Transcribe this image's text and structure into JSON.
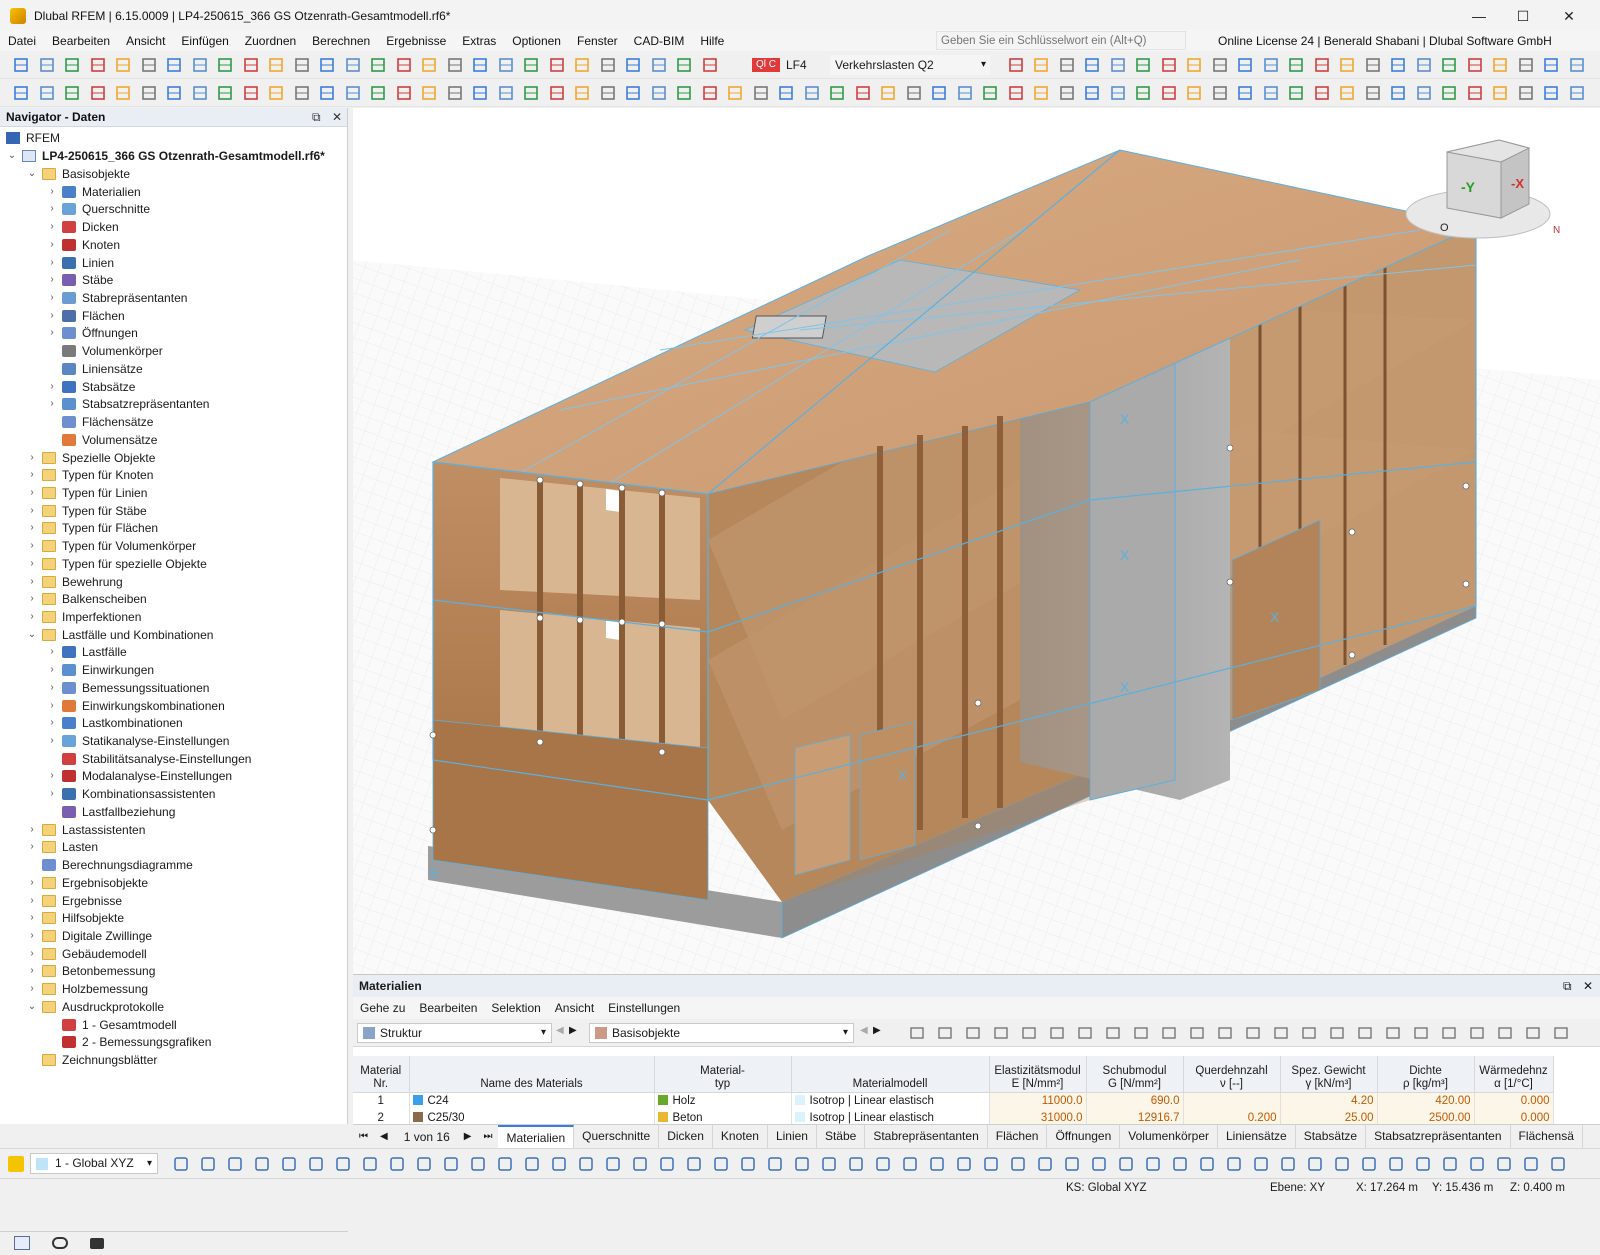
{
  "window": {
    "title": "Dlubal RFEM | 6.15.0009 | LP4-250615_366 GS Otzenrath-Gesamtmodell.rf6*",
    "minimize": "—",
    "maximize": "☐",
    "close": "✕"
  },
  "menubar": {
    "items": [
      "Datei",
      "Bearbeiten",
      "Ansicht",
      "Einfügen",
      "Zuordnen",
      "Berechnen",
      "Ergebnisse",
      "Extras",
      "Optionen",
      "Fenster",
      "CAD-BIM",
      "Hilfe"
    ],
    "search_placeholder": "Geben Sie ein Schlüsselwort ein (Alt+Q)",
    "license": "Online License 24 | Benerald Shabani | Dlubal Software GmbH"
  },
  "loadcase": {
    "badge": "Ql C",
    "name": "LF4",
    "description": "Verkehrslasten Q2"
  },
  "navigator": {
    "title": "Navigator - Daten",
    "root": "RFEM",
    "model": "LP4-250615_366 GS Otzenrath-Gesamtmodell.rf6*",
    "items": [
      {
        "label": "Basisobjekte",
        "level": 1,
        "expanded": true,
        "icon": "folder"
      },
      {
        "label": "Materialien",
        "level": 2,
        "icon": "materials-icon"
      },
      {
        "label": "Querschnitte",
        "level": 2,
        "icon": "cross-section-icon"
      },
      {
        "label": "Dicken",
        "level": 2,
        "icon": "thickness-icon"
      },
      {
        "label": "Knoten",
        "level": 2,
        "icon": "node-icon"
      },
      {
        "label": "Linien",
        "level": 2,
        "icon": "line-icon"
      },
      {
        "label": "Stäbe",
        "level": 2,
        "icon": "member-icon"
      },
      {
        "label": "Stabrepräsentanten",
        "level": 2,
        "icon": "member-rep-icon"
      },
      {
        "label": "Flächen",
        "level": 2,
        "icon": "surface-icon"
      },
      {
        "label": "Öffnungen",
        "level": 2,
        "icon": "opening-icon"
      },
      {
        "label": "Volumenkörper",
        "level": 2,
        "noexpand": true,
        "icon": "solid-icon"
      },
      {
        "label": "Liniensätze",
        "level": 2,
        "noexpand": true,
        "icon": "line-set-icon"
      },
      {
        "label": "Stabsätze",
        "level": 2,
        "icon": "member-set-icon"
      },
      {
        "label": "Stabsatzrepräsentanten",
        "level": 2,
        "icon": "member-set-rep-icon"
      },
      {
        "label": "Flächensätze",
        "level": 2,
        "noexpand": true,
        "icon": "surface-set-icon"
      },
      {
        "label": "Volumensätze",
        "level": 2,
        "noexpand": true,
        "icon": "solid-set-icon"
      },
      {
        "label": "Spezielle Objekte",
        "level": 1,
        "icon": "folder"
      },
      {
        "label": "Typen für Knoten",
        "level": 1,
        "icon": "folder"
      },
      {
        "label": "Typen für Linien",
        "level": 1,
        "icon": "folder"
      },
      {
        "label": "Typen für Stäbe",
        "level": 1,
        "icon": "folder"
      },
      {
        "label": "Typen für Flächen",
        "level": 1,
        "icon": "folder"
      },
      {
        "label": "Typen für Volumenkörper",
        "level": 1,
        "icon": "folder"
      },
      {
        "label": "Typen für spezielle Objekte",
        "level": 1,
        "icon": "folder"
      },
      {
        "label": "Bewehrung",
        "level": 1,
        "icon": "folder"
      },
      {
        "label": "Balkenscheiben",
        "level": 1,
        "icon": "folder"
      },
      {
        "label": "Imperfektionen",
        "level": 1,
        "icon": "folder"
      },
      {
        "label": "Lastfälle und Kombinationen",
        "level": 1,
        "expanded": true,
        "icon": "folder"
      },
      {
        "label": "Lastfälle",
        "level": 2,
        "icon": "load-case-icon"
      },
      {
        "label": "Einwirkungen",
        "level": 2,
        "icon": "action-icon"
      },
      {
        "label": "Bemessungssituationen",
        "level": 2,
        "icon": "design-situation-icon"
      },
      {
        "label": "Einwirkungskombinationen",
        "level": 2,
        "icon": "action-combination-icon"
      },
      {
        "label": "Lastkombinationen",
        "level": 2,
        "icon": "load-combination-icon"
      },
      {
        "label": "Statikanalyse-Einstellungen",
        "level": 2,
        "icon": "static-settings-icon"
      },
      {
        "label": "Stabilitätsanalyse-Einstellungen",
        "level": 2,
        "noexpand": true,
        "icon": "stability-settings-icon"
      },
      {
        "label": "Modalanalyse-Einstellungen",
        "level": 2,
        "icon": "modal-settings-icon"
      },
      {
        "label": "Kombinationsassistenten",
        "level": 2,
        "icon": "combination-wizard-icon"
      },
      {
        "label": "Lastfallbeziehung",
        "level": 2,
        "noexpand": true,
        "icon": "relationship-icon"
      },
      {
        "label": "Lastassistenten",
        "level": 1,
        "icon": "folder"
      },
      {
        "label": "Lasten",
        "level": 1,
        "icon": "folder"
      },
      {
        "label": "Berechnungsdiagramme",
        "level": 1,
        "noexpand": true,
        "icon": "diagram-icon"
      },
      {
        "label": "Ergebnisobjekte",
        "level": 1,
        "icon": "folder"
      },
      {
        "label": "Ergebnisse",
        "level": 1,
        "icon": "folder"
      },
      {
        "label": "Hilfsobjekte",
        "level": 1,
        "icon": "folder"
      },
      {
        "label": "Digitale Zwillinge",
        "level": 1,
        "icon": "folder"
      },
      {
        "label": "Gebäudemodell",
        "level": 1,
        "icon": "folder"
      },
      {
        "label": "Betonbemessung",
        "level": 1,
        "icon": "folder"
      },
      {
        "label": "Holzbemessung",
        "level": 1,
        "icon": "folder"
      },
      {
        "label": "Ausdruckprotokolle",
        "level": 1,
        "expanded": true,
        "icon": "folder"
      },
      {
        "label": "1 - Gesamtmodell",
        "level": 2,
        "noexpand": true,
        "icon": "report-icon"
      },
      {
        "label": "2 - Bemessungsgrafiken",
        "level": 2,
        "noexpand": true,
        "icon": "report-icon"
      },
      {
        "label": "Zeichnungsblätter",
        "level": 1,
        "noexpand": true,
        "icon": "folder"
      }
    ]
  },
  "viewcube": {
    "face_front": "-Y",
    "face_right": "-X",
    "north": "N",
    "origin": "O"
  },
  "panel": {
    "title": "Materialien",
    "menu": [
      "Gehe zu",
      "Bearbeiten",
      "Selektion",
      "Ansicht",
      "Einstellungen"
    ],
    "dropdown1": "Struktur",
    "dropdown2": "Basisobjekte",
    "columns": [
      {
        "line1": "Material",
        "line2": "Nr."
      },
      {
        "line1": "",
        "line2": "Name des Materials"
      },
      {
        "line1": "Material-",
        "line2": "typ"
      },
      {
        "line1": "",
        "line2": "Materialmodell"
      },
      {
        "line1": "Elastizitätsmodul",
        "line2": "E [N/mm²]"
      },
      {
        "line1": "Schubmodul",
        "line2": "G [N/mm²]"
      },
      {
        "line1": "Querdehnzahl",
        "line2": "ν [--]"
      },
      {
        "line1": "Spez. Gewicht",
        "line2": "γ [kN/m³]"
      },
      {
        "line1": "Dichte",
        "line2": "ρ [kg/m³]"
      },
      {
        "line1": "Wärmedehnz",
        "line2": "α [1/°C]"
      }
    ],
    "rows": [
      {
        "nr": "1",
        "name": "C24",
        "name_color": "#3a9ee8",
        "type": "Holz",
        "type_color": "#6aa82a",
        "model": "Isotrop | Linear elastisch",
        "E": "11000.0",
        "G": "690.0",
        "nu": "",
        "gamma": "4.20",
        "rho": "420.00",
        "alpha": "0.000"
      },
      {
        "nr": "2",
        "name": "C25/30",
        "name_color": "#8c6b4a",
        "type": "Beton",
        "type_color": "#e8b830",
        "model": "Isotrop | Linear elastisch",
        "E": "31000.0",
        "G": "12916.7",
        "nu": "0.200",
        "gamma": "25.00",
        "rho": "2500.00",
        "alpha": "0.000"
      }
    ],
    "pager": "1 von 16",
    "tabs": [
      "Materialien",
      "Querschnitte",
      "Dicken",
      "Knoten",
      "Linien",
      "Stäbe",
      "Stabrepräsentanten",
      "Flächen",
      "Öffnungen",
      "Volumenkörper",
      "Liniensätze",
      "Stabsätze",
      "Stabsatzrepräsentanten",
      "Flächensä"
    ],
    "active_tab": "Materialien"
  },
  "bottom": {
    "view_select": "1 - Global XYZ"
  },
  "status": {
    "ks": "KS: Global XYZ",
    "ebene": "Ebene: XY",
    "x": "X: 17.264 m",
    "y": "Y: 15.436 m",
    "z": "Z: 0.400 m"
  }
}
